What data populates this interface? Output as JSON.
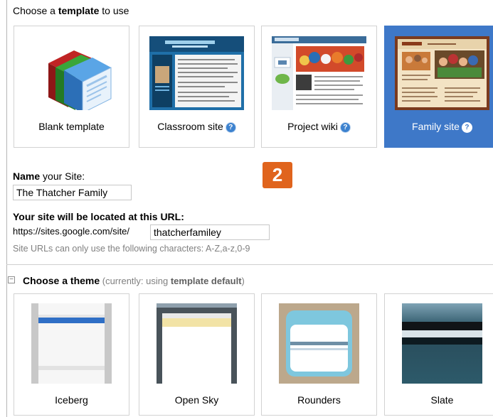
{
  "templates_section": {
    "heading_prefix": "Choose a ",
    "heading_bold": "template",
    "heading_suffix": " to use",
    "items": [
      {
        "label": "Blank template",
        "help": false
      },
      {
        "label": "Classroom site",
        "help": true
      },
      {
        "label": "Project wiki",
        "help": true
      },
      {
        "label": "Family site",
        "help": true,
        "selected": true
      }
    ],
    "help_glyph": "?"
  },
  "step_badge": "2",
  "name_field": {
    "label_bold": "Name",
    "label_rest": " your Site:",
    "value": "The Thatcher Family"
  },
  "url_field": {
    "label": "Your site will be located at this URL:",
    "prefix": "https://sites.google.com/site/",
    "value": "thatcherfamiley",
    "hint": "Site URLs can only use the following characters: A-Z,a-z,0-9"
  },
  "theme_section": {
    "collapse_glyph": "−",
    "heading": "Choose a theme",
    "sub_prefix": " (currently: using ",
    "sub_bold": "template default",
    "sub_suffix": ")",
    "items": [
      {
        "label": "Iceberg"
      },
      {
        "label": "Open Sky"
      },
      {
        "label": "Rounders"
      },
      {
        "label": "Slate"
      }
    ]
  },
  "colors": {
    "selected": "#3e78c8",
    "step_badge": "#e0641d",
    "help_icon": "#3d82cf"
  }
}
